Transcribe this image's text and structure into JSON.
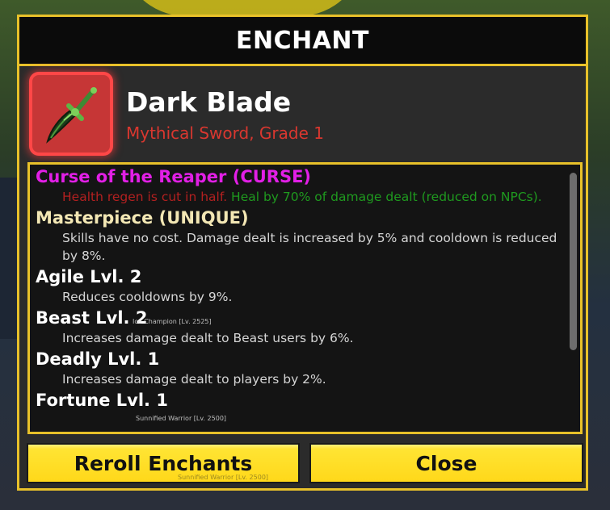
{
  "window": {
    "title": "ENCHANT"
  },
  "item": {
    "name": "Dark Blade",
    "subtitle": "Mythical Sword, Grade 1",
    "icon": "dark-blade-sword-icon",
    "rarity_color": "#c63636"
  },
  "enchants": [
    {
      "title": "Curse of the Reaper (CURSE)",
      "title_color": "#e21fe6",
      "desc_parts": [
        {
          "text": "Health regen is cut in half. ",
          "color": "#b32020"
        },
        {
          "text": "Heal by 70% of damage dealt (reduced on NPCs).",
          "color": "#1f9a1f"
        }
      ]
    },
    {
      "title": "Masterpiece (UNIQUE)",
      "title_color": "#f3e7b4",
      "desc_parts": [
        {
          "text": "Skills have no cost. Damage dealt is increased by 5% and cooldown is reduced by 8%.",
          "color": "#d6d6d6"
        }
      ]
    },
    {
      "title": "Agile Lvl. 2",
      "title_color": "#ffffff",
      "desc_parts": [
        {
          "text": "Reduces cooldowns by 9%.",
          "color": "#d6d6d6"
        }
      ]
    },
    {
      "title": "Beast Lvl. 2",
      "title_color": "#ffffff",
      "desc_parts": [
        {
          "text": "Increases damage dealt to Beast users by 6%.",
          "color": "#d6d6d6"
        }
      ]
    },
    {
      "title": "Deadly Lvl. 1",
      "title_color": "#ffffff",
      "desc_parts": [
        {
          "text": "Increases damage dealt to players by 2%.",
          "color": "#d6d6d6"
        }
      ]
    },
    {
      "title": "Fortune Lvl. 1",
      "title_color": "#ffffff",
      "desc_parts": []
    }
  ],
  "buttons": {
    "reroll_label": "Reroll Enchants",
    "close_label": "Close",
    "color": "#ffd81a"
  },
  "overlays": {
    "tag1": "Ice Champion [Lv. 2525]",
    "tag2": "Sunnified Warrior [Lv. 2500]",
    "tag3": "Sunnified Warrior [Lv. 2500]"
  },
  "colors": {
    "border": "#e8c12a",
    "panel_bg": "#2b2b2b",
    "list_bg": "#141414"
  }
}
